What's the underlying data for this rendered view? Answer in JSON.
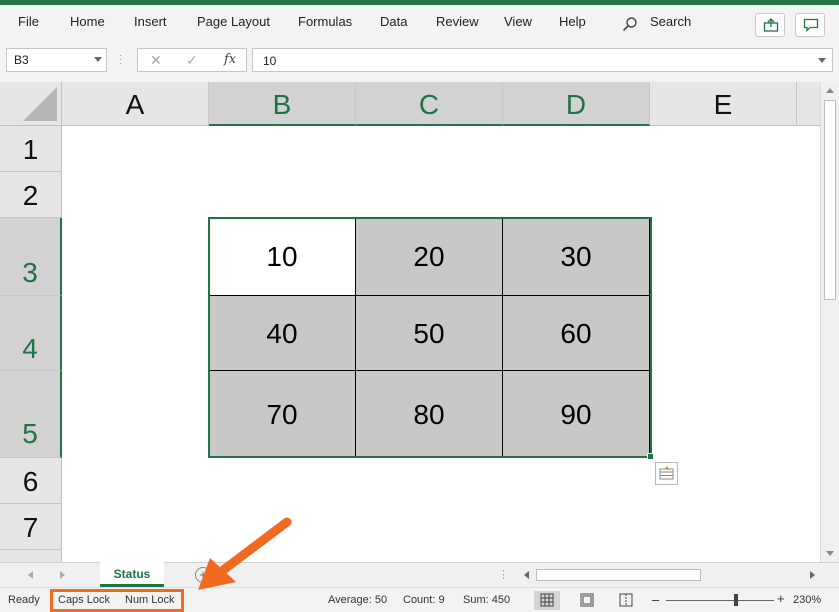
{
  "ribbon": {
    "tabs": [
      "File",
      "Home",
      "Insert",
      "Page Layout",
      "Formulas",
      "Data",
      "Review",
      "View",
      "Help"
    ],
    "search_label": "Search"
  },
  "formula_bar": {
    "name_box": "B3",
    "cancel_symbol": "✕",
    "enter_symbol": "✓",
    "fx_label": "fx",
    "formula_value": "10"
  },
  "sheet": {
    "columns": [
      "A",
      "B",
      "C",
      "D",
      "E"
    ],
    "rows": [
      "1",
      "2",
      "3",
      "4",
      "5",
      "6",
      "7"
    ],
    "selected_columns": [
      "B",
      "C",
      "D"
    ],
    "selected_rows": [
      "3",
      "4",
      "5"
    ],
    "cells": [
      [
        "10",
        "20",
        "30"
      ],
      [
        "40",
        "50",
        "60"
      ],
      [
        "70",
        "80",
        "90"
      ]
    ],
    "active_cell": "B3"
  },
  "tabs": {
    "sheet_name": "Status",
    "add_sheet_symbol": "+"
  },
  "status": {
    "ready": "Ready",
    "caps_lock": "Caps Lock",
    "num_lock": "Num Lock",
    "average": "Average: 50",
    "count": "Count: 9",
    "sum": "Sum: 450",
    "zoom_minus": "–",
    "zoom_plus": "+",
    "zoom": "230%"
  },
  "colors": {
    "accent": "#217346",
    "selection_fill": "#c8c8c8",
    "callout": "#f06a1f"
  },
  "icons": {
    "search": "search-icon",
    "share": "share-icon",
    "comments": "comment-icon",
    "quick_analysis": "quick-analysis-icon",
    "normal_view": "normal-view-icon",
    "page_layout_view": "page-layout-view-icon",
    "page_break_view": "page-break-view-icon"
  }
}
